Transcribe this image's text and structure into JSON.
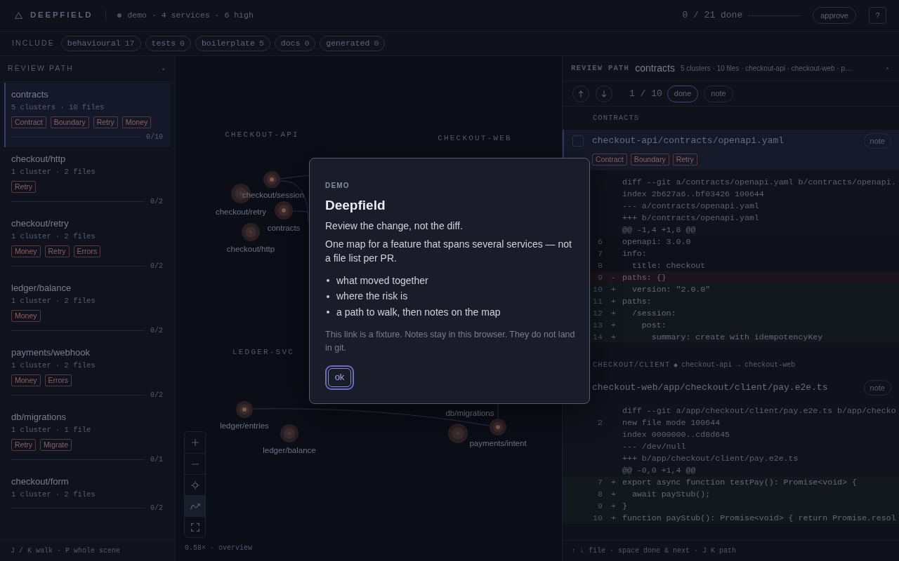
{
  "topbar": {
    "brand": "DEEPFIELD",
    "summary": "demo · 4 services · 6 high",
    "progress": {
      "text": "0 / 21 done",
      "level": 0
    },
    "approve": "approve",
    "help": "?"
  },
  "filters": {
    "label": "INCLUDE",
    "chips": [
      {
        "label": "behavioural",
        "count": "17"
      },
      {
        "label": "tests",
        "count": "0"
      },
      {
        "label": "boilerplate",
        "count": "5"
      },
      {
        "label": "docs",
        "count": "0"
      },
      {
        "label": "generated",
        "count": "0"
      }
    ]
  },
  "sidebar": {
    "title": "REVIEW PATH",
    "items": [
      {
        "title": "contracts",
        "meta": "5 clusters · 10 files",
        "tags": [
          "Contract",
          "Boundary",
          "Retry",
          "Money"
        ],
        "progress": "0/10",
        "level": 0,
        "selected": true
      },
      {
        "title": "checkout/http",
        "meta": "1 cluster · 2 files",
        "tags": [
          "Retry"
        ],
        "progress": "0/2",
        "level": 0,
        "selected": false
      },
      {
        "title": "checkout/retry",
        "meta": "1 cluster · 2 files",
        "tags": [
          "Money",
          "Retry",
          "Errors"
        ],
        "progress": "0/2",
        "level": 0,
        "selected": false
      },
      {
        "title": "ledger/balance",
        "meta": "1 cluster · 2 files",
        "tags": [
          "Money"
        ],
        "progress": "0/2",
        "level": 0,
        "selected": false
      },
      {
        "title": "payments/webhook",
        "meta": "1 cluster · 2 files",
        "tags": [
          "Money",
          "Errors"
        ],
        "progress": "0/2",
        "level": 0,
        "selected": false
      },
      {
        "title": "db/migrations",
        "meta": "1 cluster · 1 file",
        "tags": [
          "Retry",
          "Migrate"
        ],
        "progress": "0/1",
        "level": 0,
        "selected": false
      },
      {
        "title": "checkout/form",
        "meta": "1 cluster · 2 files",
        "progress": "0/2",
        "level": 0,
        "selected": false
      }
    ],
    "footer": "J / K walk · P whole scene"
  },
  "map": {
    "groups": [
      "CHECKOUT-API",
      "CHECKOUT-WEB",
      "LEDGER-SVC"
    ],
    "nodes": [
      {
        "label": "checkout/session",
        "kind": "core"
      },
      {
        "label": "checkout/retry",
        "kind": "soft"
      },
      {
        "label": "contracts",
        "kind": "core"
      },
      {
        "label": "checkout/http",
        "kind": "soft"
      },
      {
        "label": "ledger/entries",
        "kind": "core"
      },
      {
        "label": "ledger/balance",
        "kind": "soft"
      },
      {
        "label": "db/migrations",
        "kind": "soft"
      },
      {
        "label": "payments/intent",
        "kind": "core"
      }
    ],
    "tools": [
      {
        "kind": "zoom_in",
        "selected": false
      },
      {
        "kind": "zoom_out",
        "selected": false
      },
      {
        "kind": "locate",
        "selected": false
      },
      {
        "kind": "path",
        "selected": true
      },
      {
        "kind": "fit",
        "selected": false
      }
    ],
    "status": "0.58× · overview"
  },
  "review": {
    "label": "REVIEW PATH",
    "title": "contracts",
    "meta": "5 clusters · 10 files · checkout-api · checkout-web · p…",
    "position": "1 / 10",
    "actions": [
      {
        "label": "done",
        "highlighted": true
      },
      {
        "label": "note",
        "highlighted": false
      }
    ],
    "sections": [
      {
        "title": "CONTRACTS",
        "files": [
          {
            "path": "checkout-api/contracts/openapi.yaml",
            "selected": true,
            "checked": false,
            "note": "note",
            "tags": [
              "Contract",
              "Boundary",
              "Retry"
            ],
            "lines": [
              {
                "kind": "meta",
                "text": "diff --git a/contracts/openapi.yaml b/contracts/openapi."
              },
              {
                "kind": "meta",
                "text": "index 2b627a6..bf03426 100644"
              },
              {
                "kind": "meta",
                "text": "--- a/contracts/openapi.yaml"
              },
              {
                "kind": "meta",
                "text": "+++ b/contracts/openapi.yaml"
              },
              {
                "kind": "meta",
                "text": "@@ -1,4 +1,8 @@"
              },
              {
                "kind": "context",
                "num": "6",
                "text": "openapi: 3.0.0"
              },
              {
                "kind": "context",
                "num": "7",
                "text": "info:"
              },
              {
                "kind": "context",
                "num": "8",
                "text": "  title: checkout"
              },
              {
                "kind": "del",
                "num": "9",
                "sign": "-",
                "text": "paths: {}"
              },
              {
                "kind": "add",
                "num": "10",
                "sign": "+",
                "text": "  version: \"2.0.0\""
              },
              {
                "kind": "add",
                "num": "11",
                "sign": "+",
                "text": "paths:"
              },
              {
                "kind": "add",
                "num": "12",
                "sign": "+",
                "text": "  /session:"
              },
              {
                "kind": "add",
                "num": "13",
                "sign": "+",
                "text": "    post:"
              },
              {
                "kind": "add",
                "num": "14",
                "sign": "+",
                "text": "      summary: create with idempotencyKey"
              }
            ]
          }
        ]
      },
      {
        "title": "CHECKOUT/CLIENT",
        "route": "checkout-api → checkout-web",
        "files": [
          {
            "path": "checkout-web/app/checkout/client/pay.e2e.ts",
            "selected": false,
            "note": "note",
            "lines": [
              {
                "kind": "meta",
                "text": "diff --git a/app/checkout/client/pay.e2e.ts b/app/checko"
              },
              {
                "kind": "meta",
                "num": "2",
                "text": "new file mode 100644"
              },
              {
                "kind": "meta",
                "text": "index 0000000..cd8d645"
              },
              {
                "kind": "meta",
                "text": "--- /dev/null"
              },
              {
                "kind": "meta",
                "text": "+++ b/app/checkout/client/pay.e2e.ts"
              },
              {
                "kind": "meta",
                "text": "@@ -0,0 +1,4 @@"
              },
              {
                "kind": "add",
                "num": "7",
                "sign": "+",
                "text": "export async function testPay(): Promise<void> {"
              },
              {
                "kind": "add",
                "num": "8",
                "sign": "+",
                "text": "  await payStub();"
              },
              {
                "kind": "add",
                "num": "9",
                "sign": "+",
                "text": "}"
              },
              {
                "kind": "add",
                "num": "10",
                "sign": "+",
                "text": "function payStub(): Promise<void> { return Promise.resol"
              }
            ]
          }
        ]
      }
    ],
    "footer": "↑ ↓ file · space done & next · J K path"
  },
  "dialog": {
    "eyebrow": "DEMO",
    "title": "Deepfield",
    "lead": "Review the change, not the diff.",
    "body": "One map for a feature that spans several services — not a file list per PR.",
    "points": [
      "what moved together",
      "where the risk is",
      "a path to walk, then notes on the map"
    ],
    "note": "This link is a fixture. Notes stay in this browser. They do not land in git.",
    "button": {
      "label": "ok",
      "focused": true
    }
  }
}
